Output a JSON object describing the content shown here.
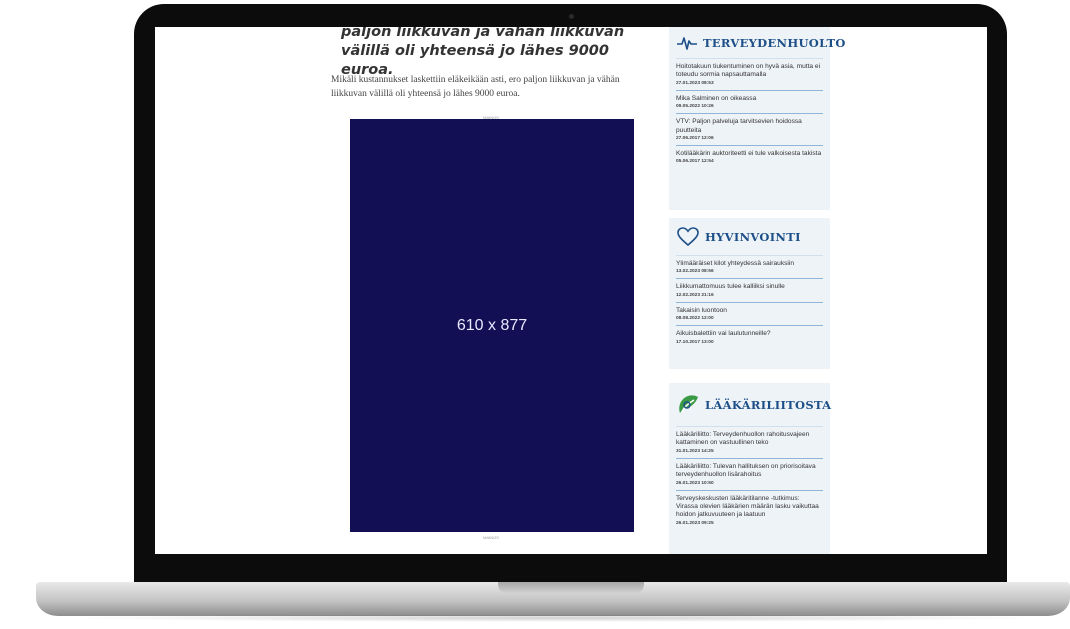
{
  "article": {
    "heading": "paljon liikkuvan ja vähän liikkuvan välillä oli yhteensä jo lähes 9000 euroa.",
    "body": "Mikäli kustannukset laskettiin eläkeikään asti, ero paljon liikkuvan ja vähän liikkuvan välillä oli yhteensä jo lähes 9000 euroa.",
    "ad_label_top": "MAINOS",
    "ad_label_bottom": "MAINOS",
    "ad_placeholder": "610 x 877"
  },
  "sidebar": {
    "terveydenhuolto": {
      "title": "TERVEYDENHUOLTO",
      "icon": "pulse-icon",
      "items": [
        {
          "title": "Hoitotakuun tiukentuminen on hyvä asia, mutta ei toteudu sormia napsauttamalla",
          "date": "27.01.2023 08:53"
        },
        {
          "title": "Mika Salminen on oikeassa",
          "date": "09.05.2022 10:26"
        },
        {
          "title": "VTV: Paljon palveluja tarvitsevien hoidossa puutteita",
          "date": "27.06.2017 12:06"
        },
        {
          "title": "Kotilääkärin auktoriteetti ei tule valkoisesta takista",
          "date": "05.06.2017 12:54"
        }
      ]
    },
    "hyvinvointi": {
      "title": "HYVINVOINTI",
      "icon": "heart-icon",
      "items": [
        {
          "title": "Ylimääräiset kilot yhteydessä sairauksiin",
          "date": "13.02.2023 08:56"
        },
        {
          "title": "Liikkumattomuus tulee kalliiksi sinulle",
          "date": "12.02.2023 21:16"
        },
        {
          "title": "Takaisin luontoon",
          "date": "08.08.2022 12:00"
        },
        {
          "title": "Aikuisbalettiin vai laulutunneille?",
          "date": "17.10.2017 13:00"
        }
      ]
    },
    "laakariliitosta": {
      "title": "LÄÄKÄRILIITOSTA",
      "icon": "laakariliitto-logo-icon",
      "items": [
        {
          "title": "Lääkäriliitto: Terveydenhuollon rahoitusvajeen kattaminen on vastuullinen teko",
          "date": "31.01.2023 14:25"
        },
        {
          "title": "Lääkäriliitto: Tulevan hallituksen on priorisoitava terveydenhuollon lisärahoitus",
          "date": "26.01.2023 10:50"
        },
        {
          "title": "Terveyskeskusten lääkäritilanne -tutkimus: Virassa olevien lääkärien määrän lasku vaikuttaa hoidon jatkuvuuteen ja laatuun",
          "date": "26.01.2023 09:25"
        }
      ]
    }
  },
  "colors": {
    "ad_background": "#120f55",
    "sidebar_title": "#1d4f88",
    "sidebar_background": "#eef3f8",
    "logo_green": "#3a9a45"
  }
}
